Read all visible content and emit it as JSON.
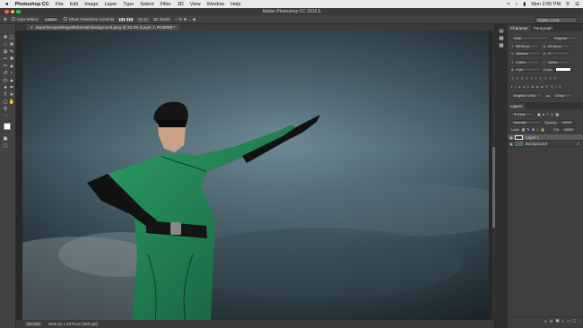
{
  "menubar": {
    "apple": "",
    "app": "Photoshop CC",
    "items": [
      "File",
      "Edit",
      "Image",
      "Layer",
      "Type",
      "Select",
      "Filter",
      "3D",
      "View",
      "Window",
      "Help"
    ],
    "clock": "Mon 2:55 PM"
  },
  "window": {
    "title": "Adobe Photoshop CC 2015.5"
  },
  "options": {
    "autoselect": "Auto-Select:",
    "target": "Layer",
    "transform": "Show Transform Controls",
    "mode3d": "3D Mode:",
    "workspace": "Dylan Local"
  },
  "document": {
    "tab": "Superheropaintingwithdramaticbackground.jpeg @ 33.3% (Layer 1, RGB/8#) *"
  },
  "status": {
    "zoom": "33.33%",
    "info": "1940 px x 1070 px (300 ppi)"
  },
  "character": {
    "tabs": [
      "Character",
      "Paragraph"
    ],
    "font": "Arial",
    "style": "Regular",
    "size": "80.05 pt",
    "leading": "25.49 pt",
    "kerning": "Metrics",
    "tracking": "0",
    "vscale": "100%",
    "hscale": "100%",
    "baseline": "0 pt",
    "color_label": "Color:",
    "language": "English: USA",
    "aa_label": "aa",
    "antialias": "Crisp"
  },
  "layers": {
    "tab": "Layers",
    "kind": "Kind",
    "blend": "Normal",
    "opacity_label": "Opacity:",
    "opacity": "100%",
    "lock_label": "Lock:",
    "fill_label": "Fill:",
    "fill": "100%",
    "items": [
      {
        "name": "Layer 1",
        "selected": true
      },
      {
        "name": "Background",
        "selected": false
      }
    ]
  },
  "colors": {
    "accent": "#1f63c9",
    "foreground": "#ffffff",
    "background": "#000000"
  }
}
